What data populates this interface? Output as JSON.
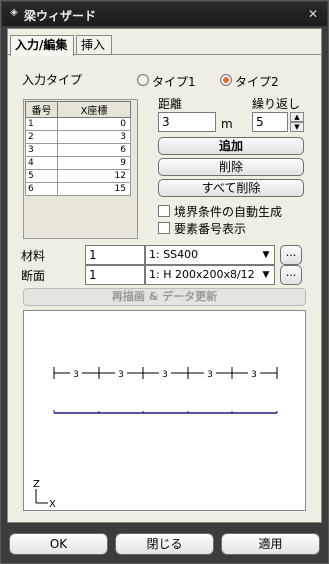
{
  "window": {
    "title": "梁ウィザード",
    "close_glyph": "✕"
  },
  "tabs": [
    {
      "label": "入力/編集"
    },
    {
      "label": "挿入"
    }
  ],
  "input_type": {
    "label": "入力タイプ",
    "options": [
      {
        "label": "タイプ1",
        "selected": false
      },
      {
        "label": "タイプ2",
        "selected": true
      }
    ]
  },
  "grid": {
    "headers": [
      "番号",
      "X座標"
    ],
    "rows": [
      {
        "no": "1",
        "x": "0"
      },
      {
        "no": "2",
        "x": "3"
      },
      {
        "no": "3",
        "x": "6"
      },
      {
        "no": "4",
        "x": "9"
      },
      {
        "no": "5",
        "x": "12"
      },
      {
        "no": "6",
        "x": "15"
      }
    ]
  },
  "distance": {
    "label": "距離",
    "value": "3",
    "unit": "m"
  },
  "repeat": {
    "label": "繰り返し",
    "value": "5"
  },
  "buttons": {
    "add": "追加",
    "delete": "削除",
    "delete_all": "すべて削除"
  },
  "options": {
    "auto_boundary": {
      "label": "境界条件の自動生成",
      "checked": false
    },
    "show_element_no": {
      "label": "要素番号表示",
      "checked": false
    }
  },
  "material": {
    "label": "材料",
    "no": "1",
    "selected": "1: SS400",
    "more": "..."
  },
  "section": {
    "label": "断面",
    "no": "1",
    "selected": "1: H 200x200x8/12",
    "more": "..."
  },
  "redraw_label": "再描画 & データ更新",
  "preview": {
    "span_label": "3",
    "axis_z": "Z",
    "axis_x": "X",
    "line_color": "#1a1a8a"
  },
  "footer": {
    "ok": "OK",
    "close": "閉じる",
    "apply": "適用"
  }
}
